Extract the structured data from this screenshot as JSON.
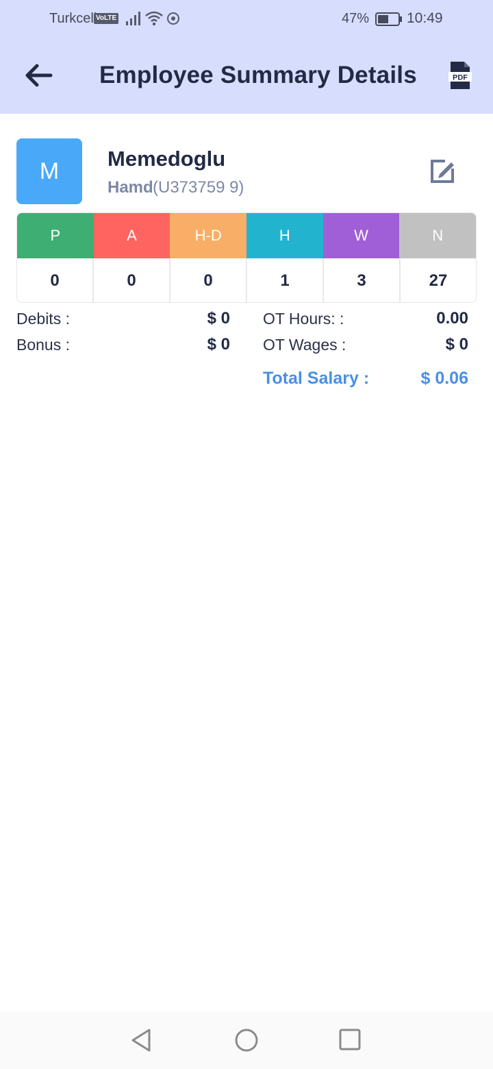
{
  "status_bar": {
    "carrier": "Turkcell",
    "volte": "VoLTE",
    "battery": "47%",
    "time": "10:49"
  },
  "header": {
    "title": "Employee Summary Details",
    "pdf_label": "PDF"
  },
  "employee": {
    "avatar_letter": "M",
    "name": "Memedoglu",
    "first_name": "Hamd",
    "id": "(U373759 9)"
  },
  "attendance": {
    "columns": [
      {
        "label": "P",
        "value": "0",
        "color": "#3fae72"
      },
      {
        "label": "A",
        "value": "0",
        "color": "#ff6461"
      },
      {
        "label": "H-D",
        "value": "0",
        "color": "#f8ae66"
      },
      {
        "label": "H",
        "value": "1",
        "color": "#22b4cf"
      },
      {
        "label": "W",
        "value": "3",
        "color": "#a05fd6"
      },
      {
        "label": "N",
        "value": "27",
        "color": "#c1c1c1"
      }
    ]
  },
  "summary": {
    "debits_label": "Debits :",
    "debits_value": "$ 0",
    "bonus_label": "Bonus :",
    "bonus_value": "$ 0",
    "ot_hours_label": "OT Hours: :",
    "ot_hours_value": "0.00",
    "ot_wages_label": "OT Wages :",
    "ot_wages_value": "$ 0",
    "total_label": "Total Salary :",
    "total_value": "$ 0.06"
  }
}
